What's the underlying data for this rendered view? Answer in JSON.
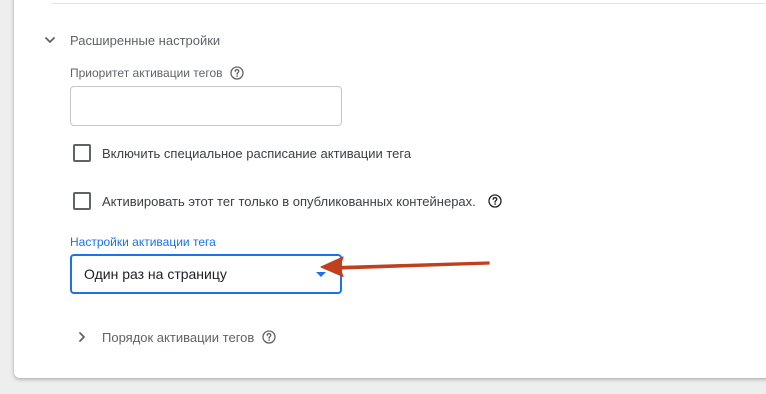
{
  "advanced_settings": {
    "title": "Расширенные настройки"
  },
  "priority": {
    "label": "Приоритет активации тегов",
    "value": "",
    "placeholder": ""
  },
  "schedule_checkbox": {
    "label": "Включить специальное расписание активации тега",
    "checked": false
  },
  "published_only_checkbox": {
    "label": "Активировать этот тег только в опубликованных контейнерах.",
    "checked": false
  },
  "firing_options": {
    "label": "Настройки активации тега",
    "selected": "Один раз на страницу"
  },
  "sequencing": {
    "title": "Порядок активации тегов"
  },
  "icons": {
    "section_chevron": "chevron-down-icon",
    "order_chevron": "chevron-right-icon",
    "help": "help-circle-icon",
    "annotation": "red-arrow"
  },
  "colors": {
    "accent": "#1a73e8",
    "annotation_arrow": "#c0401d"
  }
}
